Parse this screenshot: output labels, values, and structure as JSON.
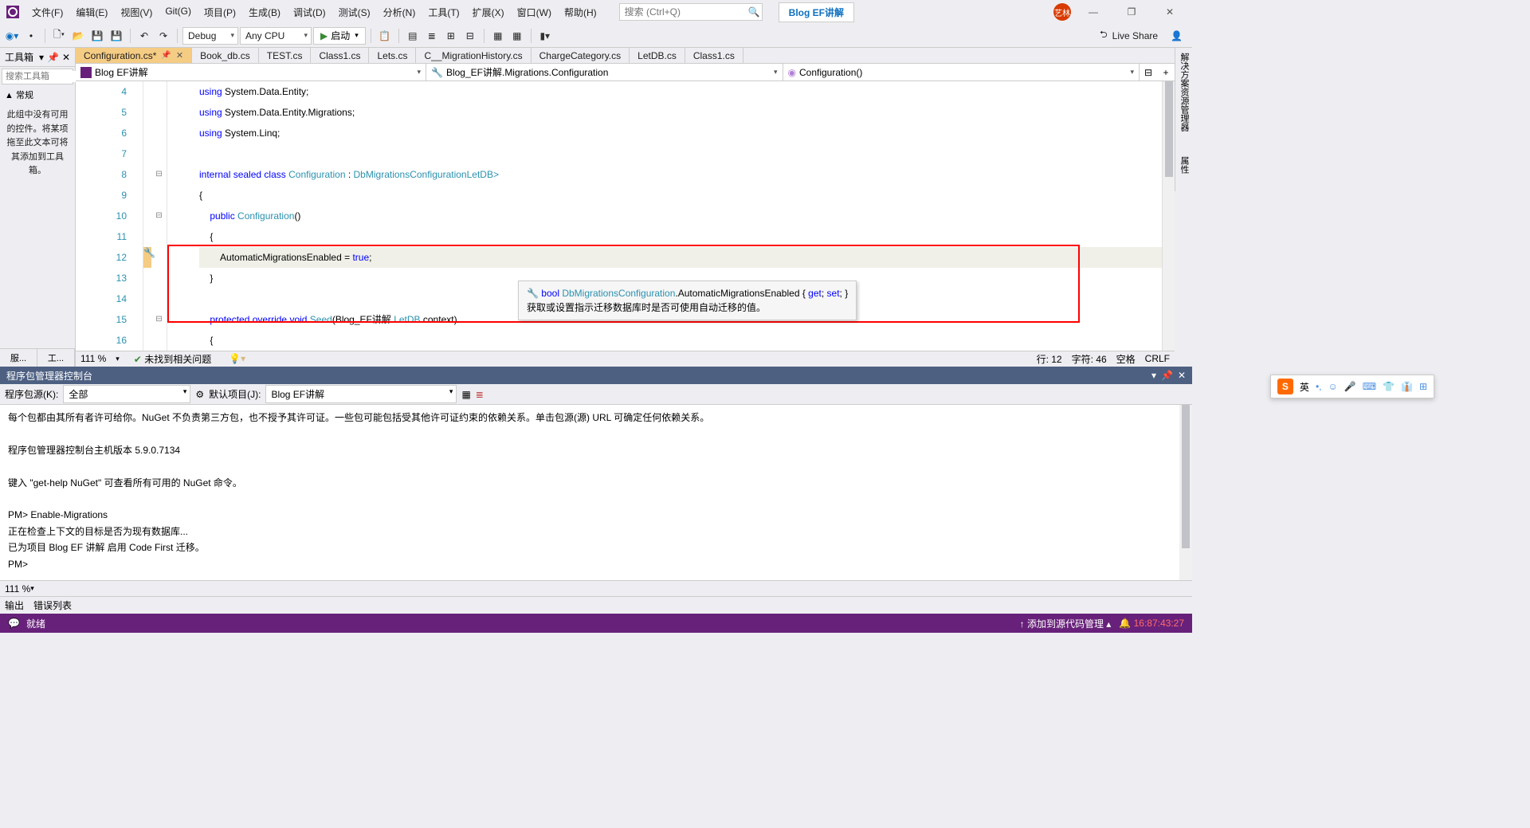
{
  "menu": [
    "文件(F)",
    "编辑(E)",
    "视图(V)",
    "Git(G)",
    "项目(P)",
    "生成(B)",
    "调试(D)",
    "测试(S)",
    "分析(N)",
    "工具(T)",
    "扩展(X)",
    "窗口(W)",
    "帮助(H)"
  ],
  "search_placeholder": "搜索 (Ctrl+Q)",
  "blog_button": "Blog EF讲解",
  "avatar": "艺林",
  "toolbar": {
    "config": "Debug",
    "platform": "Any CPU",
    "start": "启动"
  },
  "liveshare": "Live Share",
  "toolbox": {
    "title": "工具箱",
    "search": "搜索工具箱",
    "category": "▲ 常规",
    "msg": "此组中没有可用的控件。将某项拖至此文本可将其添加到工具箱。",
    "bottom": [
      "服...",
      "工..."
    ]
  },
  "tabs": [
    {
      "label": "Configuration.cs*",
      "active": true,
      "pinned": true
    },
    {
      "label": "Book_db.cs"
    },
    {
      "label": "TEST.cs"
    },
    {
      "label": "Class1.cs"
    },
    {
      "label": "Lets.cs"
    },
    {
      "label": "C__MigrationHistory.cs"
    },
    {
      "label": "ChargeCategory.cs"
    },
    {
      "label": "LetDB.cs"
    },
    {
      "label": "Class1.cs"
    }
  ],
  "nav": {
    "project": "Blog EF讲解",
    "ns": "Blog_EF讲解.Migrations.Configuration",
    "member": "Configuration()"
  },
  "code": {
    "lines": [
      {
        "n": 4,
        "t": "using System.Data.Entity;"
      },
      {
        "n": 5,
        "t": "using System.Data.Entity.Migrations;"
      },
      {
        "n": 6,
        "t": "using System.Linq;"
      },
      {
        "n": 7,
        "t": ""
      },
      {
        "n": 8,
        "t": "internal sealed class Configuration : DbMigrationsConfiguration<Blog_EF讲解.LetDB>"
      },
      {
        "n": 9,
        "t": "{"
      },
      {
        "n": 10,
        "t": "    public Configuration()"
      },
      {
        "n": 11,
        "t": "    {"
      },
      {
        "n": 12,
        "t": "        AutomaticMigrationsEnabled = true;"
      },
      {
        "n": 13,
        "t": "    }"
      },
      {
        "n": 14,
        "t": ""
      },
      {
        "n": 15,
        "t": "    protected override void Seed(Blog_EF讲解.LetDB context)"
      },
      {
        "n": 16,
        "t": "    {"
      }
    ]
  },
  "tooltip": {
    "sig_prefix": "bool ",
    "sig_type": "DbMigrationsConfiguration",
    "sig_member": ".AutomaticMigrationsEnabled { ",
    "sig_get": "get",
    "sig_set": "set",
    "desc": "获取或设置指示迁移数据库时是否可使用自动迁移的值。"
  },
  "editor_status": {
    "zoom": "111 %",
    "issues": "未找到相关问题",
    "line": "行: 12",
    "col": "字符: 46",
    "ins": "空格",
    "eol": "CRLF"
  },
  "pm": {
    "title": "程序包管理器控制台",
    "src_label": "程序包源(K):",
    "src": "全部",
    "proj_label": "默认项目(J):",
    "proj": "Blog EF讲解",
    "lines": [
      "每个包都由其所有者许可给你。NuGet 不负责第三方包，也不授予其许可证。一些包可能包括受其他许可证约束的依赖关系。单击包源(源) URL 可确定任何依赖关系。",
      "",
      "程序包管理器控制台主机版本 5.9.0.7134",
      "",
      "键入 \"get-help NuGet\" 可查看所有可用的 NuGet 命令。",
      "",
      "PM> Enable-Migrations",
      "正在检查上下文的目标是否为现有数据库...",
      "已为项目 Blog EF 讲解 启用 Code First 迁移。",
      "PM>"
    ],
    "zoom": "111 %"
  },
  "output_tabs": [
    "输出",
    "错误列表"
  ],
  "vs_status": {
    "ready": "就绪",
    "source": "↑ 添加到源代码管理 ▴",
    "notif": "16:87:43:27"
  },
  "right_panels": [
    "解决方案资源管理器",
    "属性"
  ],
  "ime": {
    "lang": "英"
  }
}
